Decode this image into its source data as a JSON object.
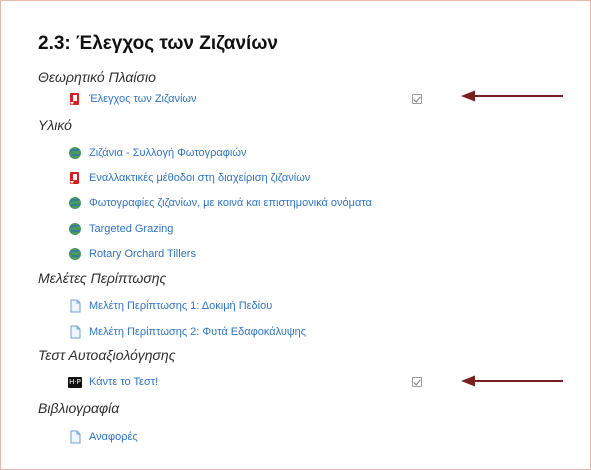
{
  "section": {
    "title": "2.3: Έλεγχος των Ζιζανίων",
    "groups": [
      {
        "label": "Θεωρητικό Πλαίσιο",
        "items": [
          {
            "type": "pdf",
            "icon": "pdf-file-icon",
            "label": "Έλεγχος των Ζιζανίων",
            "completion": true
          }
        ]
      },
      {
        "label": "Υλικό",
        "items": [
          {
            "type": "url",
            "icon": "globe-link-icon",
            "label": "Ζιζάνια - Συλλογή Φωτογραφιών",
            "completion": false
          },
          {
            "type": "pdf",
            "icon": "pdf-file-icon",
            "label": "Εναλλακτικές μέθοδοι στη διαχείριση ζιζανίων",
            "completion": false
          },
          {
            "type": "url",
            "icon": "globe-link-icon",
            "label": "Φωτογραφίες ζιζανίων, με κοινά και επιστημονικά ονόματα",
            "completion": false
          },
          {
            "type": "url",
            "icon": "globe-link-icon",
            "label": "Targeted Grazing",
            "completion": false
          },
          {
            "type": "url",
            "icon": "globe-link-icon",
            "label": "Rotary Orchard Tillers",
            "completion": false
          }
        ]
      },
      {
        "label": "Μελέτες Περίπτωσης",
        "items": [
          {
            "type": "page",
            "icon": "page-icon",
            "label": "Μελέτη Περίπτωσης 1: Δοκιμή Πεδίου",
            "completion": false
          },
          {
            "type": "page",
            "icon": "page-icon",
            "label": "Μελέτη Περίπτωσης 2: Φυτά Εδαφοκάλυψης",
            "completion": false
          }
        ]
      },
      {
        "label": "Τεστ Αυτοαξιολόγησης",
        "items": [
          {
            "type": "h5p",
            "icon": "h5p-icon",
            "icon_text": "H·P",
            "label": "Κάντε το Τεστ!",
            "completion": true
          }
        ]
      },
      {
        "label": "Βιβλιογραφία",
        "items": [
          {
            "type": "page",
            "icon": "page-icon",
            "label": "Αναφορές",
            "completion": false
          }
        ]
      }
    ]
  },
  "colors": {
    "link": "#2e74c9",
    "arrow": "#7a1f1f",
    "border": "#e6b8ad",
    "pdf": "#d61f1f"
  },
  "annotations": [
    {
      "name": "annotation-arrow-theory"
    },
    {
      "name": "annotation-arrow-quiz"
    }
  ]
}
